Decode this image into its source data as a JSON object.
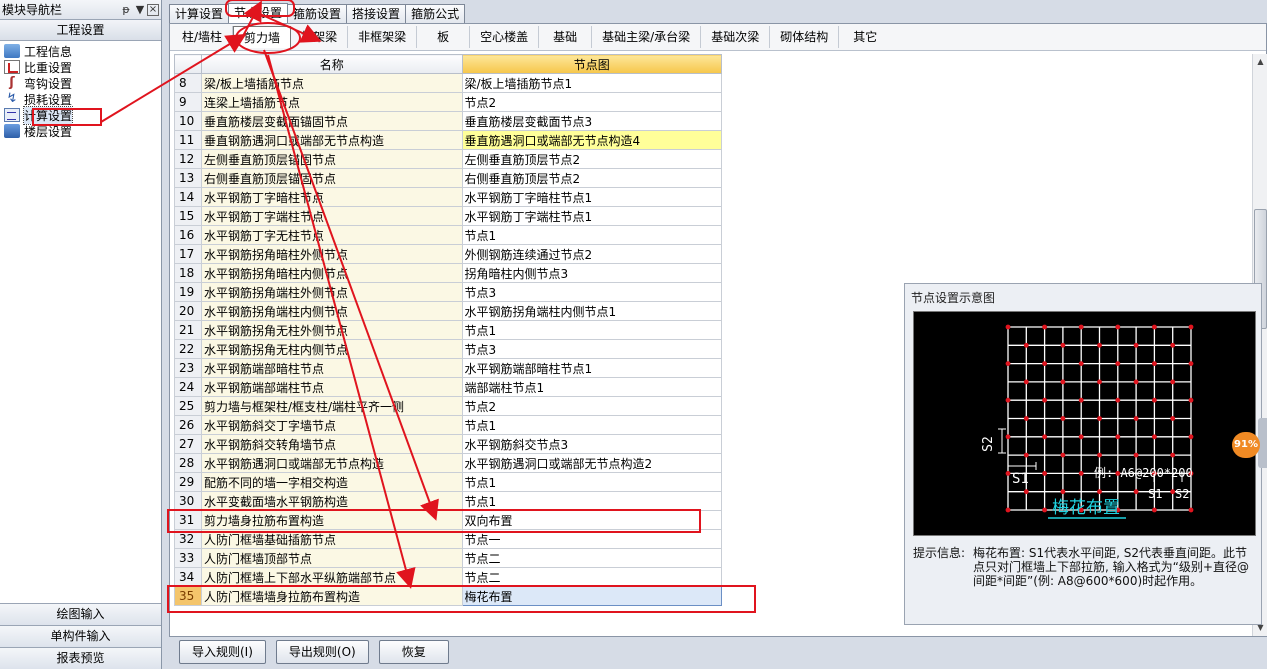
{
  "nav": {
    "title": "模块导航栏",
    "pin": "ᵽ",
    "dropdown": "▼",
    "close": "×",
    "section": "工程设置",
    "items": [
      {
        "label": "工程信息",
        "icon": "info-icon"
      },
      {
        "label": "比重设置",
        "icon": "ratio-icon"
      },
      {
        "label": "弯钩设置",
        "icon": "hook-icon"
      },
      {
        "label": "损耗设置",
        "icon": "loss-icon"
      },
      {
        "label": "计算设置",
        "icon": "calc-icon"
      },
      {
        "label": "楼层设置",
        "icon": "floor-icon"
      }
    ],
    "bottom": [
      "绘图输入",
      "单构件输入",
      "报表预览"
    ]
  },
  "tabs": [
    "计算设置",
    "节点设置",
    "箍筋设置",
    "搭接设置",
    "箍筋公式"
  ],
  "subtabs": [
    "柱/墙柱",
    "剪力墙",
    "框架梁",
    "非框架梁",
    "板",
    "空心楼盖",
    "基础",
    "基础主梁/承台梁",
    "基础次梁",
    "砌体结构",
    "其它"
  ],
  "table": {
    "headers": [
      "名称",
      "节点图"
    ],
    "rows": [
      {
        "n": "8",
        "name": "梁/板上墙插筋节点",
        "node": "梁/板上墙插筋节点1"
      },
      {
        "n": "9",
        "name": "连梁上墙插筋节点",
        "node": "节点2"
      },
      {
        "n": "10",
        "name": "垂直筋楼层变截面锚固节点",
        "node": "垂直筋楼层变截面节点3"
      },
      {
        "n": "11",
        "name": "垂直钢筋遇洞口或端部无节点构造",
        "node": "垂直筋遇洞口或端部无节点构造4"
      },
      {
        "n": "12",
        "name": "左侧垂直筋顶层锚固节点",
        "node": "左侧垂直筋顶层节点2"
      },
      {
        "n": "13",
        "name": "右侧垂直筋顶层锚固节点",
        "node": "右侧垂直筋顶层节点2"
      },
      {
        "n": "14",
        "name": "水平钢筋丁字暗柱节点",
        "node": "水平钢筋丁字暗柱节点1"
      },
      {
        "n": "15",
        "name": "水平钢筋丁字端柱节点",
        "node": "水平钢筋丁字端柱节点1"
      },
      {
        "n": "16",
        "name": "水平钢筋丁字无柱节点",
        "node": "节点1"
      },
      {
        "n": "17",
        "name": "水平钢筋拐角暗柱外侧节点",
        "node": "外侧钢筋连续通过节点2"
      },
      {
        "n": "18",
        "name": "水平钢筋拐角暗柱内侧节点",
        "node": "拐角暗柱内侧节点3"
      },
      {
        "n": "19",
        "name": "水平钢筋拐角端柱外侧节点",
        "node": "节点3"
      },
      {
        "n": "20",
        "name": "水平钢筋拐角端柱内侧节点",
        "node": "水平钢筋拐角端柱内侧节点1"
      },
      {
        "n": "21",
        "name": "水平钢筋拐角无柱外侧节点",
        "node": "节点1"
      },
      {
        "n": "22",
        "name": "水平钢筋拐角无柱内侧节点",
        "node": "节点3"
      },
      {
        "n": "23",
        "name": "水平钢筋端部暗柱节点",
        "node": "水平钢筋端部暗柱节点1"
      },
      {
        "n": "24",
        "name": "水平钢筋端部端柱节点",
        "node": "端部端柱节点1"
      },
      {
        "n": "25",
        "name": "剪力墙与框架柱/框支柱/端柱平齐一侧",
        "node": "节点2"
      },
      {
        "n": "26",
        "name": "水平钢筋斜交丁字墙节点",
        "node": "节点1"
      },
      {
        "n": "27",
        "name": "水平钢筋斜交转角墙节点",
        "node": "水平钢筋斜交节点3"
      },
      {
        "n": "28",
        "name": "水平钢筋遇洞口或端部无节点构造",
        "node": "水平钢筋遇洞口或端部无节点构造2"
      },
      {
        "n": "29",
        "name": "配筋不同的墙一字相交构造",
        "node": "节点1"
      },
      {
        "n": "30",
        "name": "水平变截面墙水平钢筋构造",
        "node": "节点1"
      },
      {
        "n": "31",
        "name": "剪力墙身拉筋布置构造",
        "node": "双向布置"
      },
      {
        "n": "32",
        "name": "人防门框墙基础插筋节点",
        "node": "节点一"
      },
      {
        "n": "33",
        "name": "人防门框墙顶部节点",
        "node": "节点二"
      },
      {
        "n": "34",
        "name": "人防门框墙上下部水平纵筋端部节点",
        "node": "节点二"
      },
      {
        "n": "35",
        "name": "人防门框墙墙身拉筋布置构造",
        "node": "梅花布置"
      }
    ]
  },
  "buttons": [
    "导入规则(I)",
    "导出规则(O)",
    "恢复"
  ],
  "preview": {
    "title": "节点设置示意图",
    "diagram": {
      "s2": "S2",
      "s1": "S1",
      "example": "例: A6@200*200",
      "s1b": "S1",
      "s2b": "S2",
      "caption": "梅花布置"
    },
    "hint_label": "提示信息:",
    "hint_text": "梅花布置: S1代表水平间距, S2代表垂直间距。此节点只对门框墙上下部拉筋, 输入格式为“级别+直径@间距*间距”(例: A8@600*600)时起作用。"
  },
  "percent": "91%",
  "colors": {
    "accent": "#f08a24",
    "annotation": "#e0141e",
    "header_highlight": "#f6c64a",
    "selected_row": "#dce8f8"
  }
}
